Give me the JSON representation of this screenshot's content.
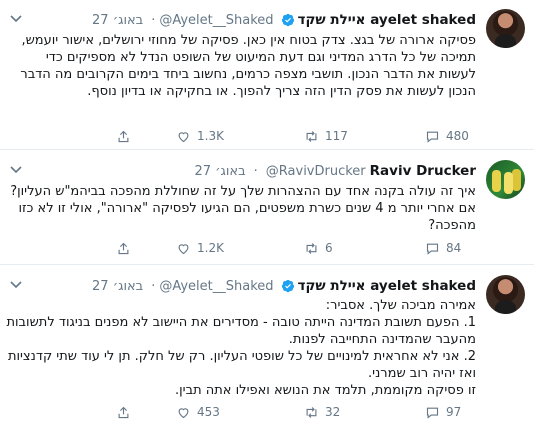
{
  "tweets": [
    {
      "display_name": "איילת שקד ayelet shaked",
      "handle": "@Ayelet__Shaked",
      "date": "27 באוג׳",
      "verified": true,
      "avatar": "female-portrait",
      "text": "פסיקה ארורה של בגצ. צדק בטוח אין כאן. פסיקה של מחוזי ירושלים, אישור יועמש, תמיכה של כל הדרג המדיני וגם דעת המיעוט של השופט הנדל לא מספיקים כדי לעשות את הדבר הנכון. תושבי מצפה כרמים, נחשוב ביחד בימים הקרובים מה הדבר הנכון לעשות את פסק הדין הזה צריך להפוך. או בחקיקה או בדיון נוסף.",
      "replies": "480",
      "retweets": "117",
      "likes": "1.3K"
    },
    {
      "display_name": "Raviv Drucker",
      "handle": "@RavivDrucker",
      "date": "27 באוג׳",
      "verified": false,
      "avatar": "raviv-photo",
      "text": "איך זה עולה בקנה אחד עם ההצהרות שלך על זה שחוללת מהפכה בביהמ\"ש העליון? אם אחרי יותר מ 4 שנים כשרת משפטים, הם הגיעו לפסיקה \"ארורה\", אולי זו לא כזו מהפכה?",
      "replies": "84",
      "retweets": "6",
      "likes": "1.2K"
    },
    {
      "display_name": "איילת שקד ayelet shaked",
      "handle": "@Ayelet__Shaked",
      "date": "27 באוג׳",
      "verified": true,
      "avatar": "female-portrait",
      "text": "אמירה מביכה שלך. אסביר:\n1. הפעם תשובת המדינה הייתה טובה - מסדירים את היישוב לא מפנים בניגוד לתשובות מהעבר שהמדינה התחייבה לפנות.\n2. אני לא אחראית למינויים של כל שופטי העליון. רק של חלק. תן לי עוד שתי קדנציות ואז יהיה רוב שמרני.\nזו פסיקה מקוממת, תלמד את הנושא ואפילו אתה תבין.",
      "replies": "97",
      "retweets": "32",
      "likes": "453"
    }
  ],
  "icons": {
    "reply": "reply-icon",
    "retweet": "retweet-icon",
    "like": "like-icon",
    "share": "share-icon",
    "verified": "verified-badge-icon",
    "more": "chevron-down-icon"
  },
  "colors": {
    "verified": "#1da1f2",
    "secondary_text": "#657786",
    "divider": "#e6ecf0"
  }
}
